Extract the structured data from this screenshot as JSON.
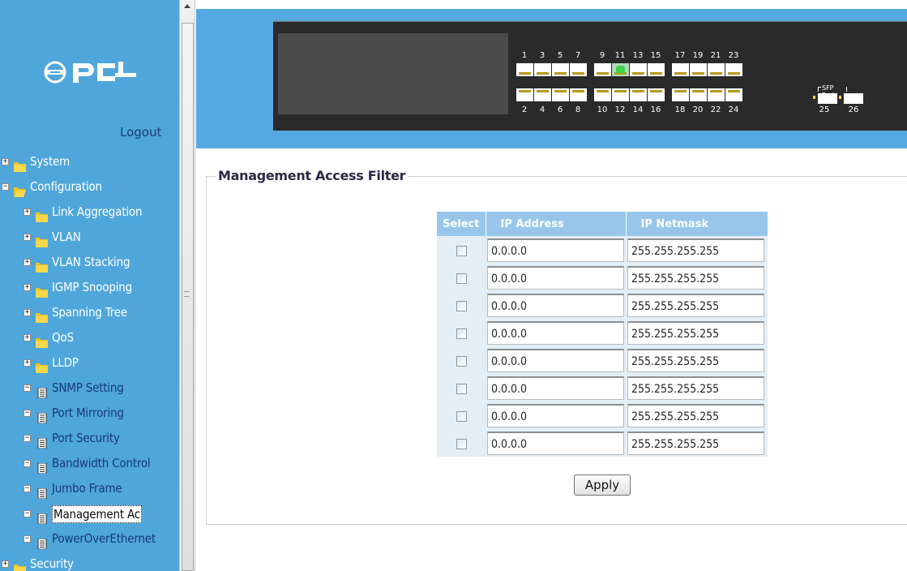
{
  "nav": {
    "logo_text": "PCI",
    "logout_label": "Logout",
    "tree": [
      {
        "label": "System",
        "type": "folder",
        "level": 0,
        "state": "collapsed"
      },
      {
        "label": "Configuration",
        "type": "folder-open",
        "level": 0,
        "state": "expanded"
      },
      {
        "label": "Link Aggregation",
        "type": "folder",
        "level": 1,
        "state": "collapsed"
      },
      {
        "label": "VLAN",
        "type": "folder",
        "level": 1,
        "state": "collapsed"
      },
      {
        "label": "VLAN Stacking",
        "type": "folder",
        "level": 1,
        "state": "collapsed"
      },
      {
        "label": "IGMP Snooping",
        "type": "folder",
        "level": 1,
        "state": "collapsed"
      },
      {
        "label": "Spanning Tree",
        "type": "folder",
        "level": 1,
        "state": "collapsed"
      },
      {
        "label": "QoS",
        "type": "folder",
        "level": 1,
        "state": "collapsed"
      },
      {
        "label": "LLDP",
        "type": "folder",
        "level": 1,
        "state": "collapsed"
      },
      {
        "label": "SNMP Setting",
        "type": "page",
        "level": 1,
        "state": "leaf"
      },
      {
        "label": "Port Mirroring",
        "type": "page",
        "level": 1,
        "state": "leaf"
      },
      {
        "label": "Port Security",
        "type": "page",
        "level": 1,
        "state": "leaf"
      },
      {
        "label": "Bandwidth Control",
        "type": "page",
        "level": 1,
        "state": "leaf"
      },
      {
        "label": "Jumbo Frame",
        "type": "page",
        "level": 1,
        "state": "leaf"
      },
      {
        "label": "Management Ac",
        "type": "page",
        "level": 1,
        "state": "selected"
      },
      {
        "label": "PowerOverEthernet",
        "type": "page",
        "level": 1,
        "state": "leaf"
      },
      {
        "label": "Security",
        "type": "folder",
        "level": 0,
        "state": "collapsed"
      }
    ]
  },
  "switch_panel": {
    "top_ports": [
      "1",
      "3",
      "5",
      "7",
      "9",
      "11",
      "13",
      "15",
      "17",
      "19",
      "21",
      "23"
    ],
    "bottom_ports": [
      "2",
      "4",
      "6",
      "8",
      "10",
      "12",
      "14",
      "16",
      "18",
      "20",
      "22",
      "24"
    ],
    "active_port": "11",
    "sfp_label": "SFP Port",
    "sfp_ports": [
      "25",
      "26"
    ]
  },
  "page": {
    "title": "Management Access Filter",
    "table": {
      "headers": {
        "select": "Select",
        "ip": "IP Address",
        "netmask": "IP Netmask"
      },
      "rows": [
        {
          "selected": false,
          "ip": "0.0.0.0",
          "netmask": "255.255.255.255"
        },
        {
          "selected": false,
          "ip": "0.0.0.0",
          "netmask": "255.255.255.255"
        },
        {
          "selected": false,
          "ip": "0.0.0.0",
          "netmask": "255.255.255.255"
        },
        {
          "selected": false,
          "ip": "0.0.0.0",
          "netmask": "255.255.255.255"
        },
        {
          "selected": false,
          "ip": "0.0.0.0",
          "netmask": "255.255.255.255"
        },
        {
          "selected": false,
          "ip": "0.0.0.0",
          "netmask": "255.255.255.255"
        },
        {
          "selected": false,
          "ip": "0.0.0.0",
          "netmask": "255.255.255.255"
        },
        {
          "selected": false,
          "ip": "0.0.0.0",
          "netmask": "255.255.255.255"
        }
      ]
    },
    "apply_label": "Apply"
  },
  "colors": {
    "nav_bg": "#4fa6db",
    "header_bg": "#54a9e0",
    "table_header_bg": "#97c6ea",
    "table_row_bg": "#e4eef6",
    "active_port_led": "#3fd24b"
  }
}
